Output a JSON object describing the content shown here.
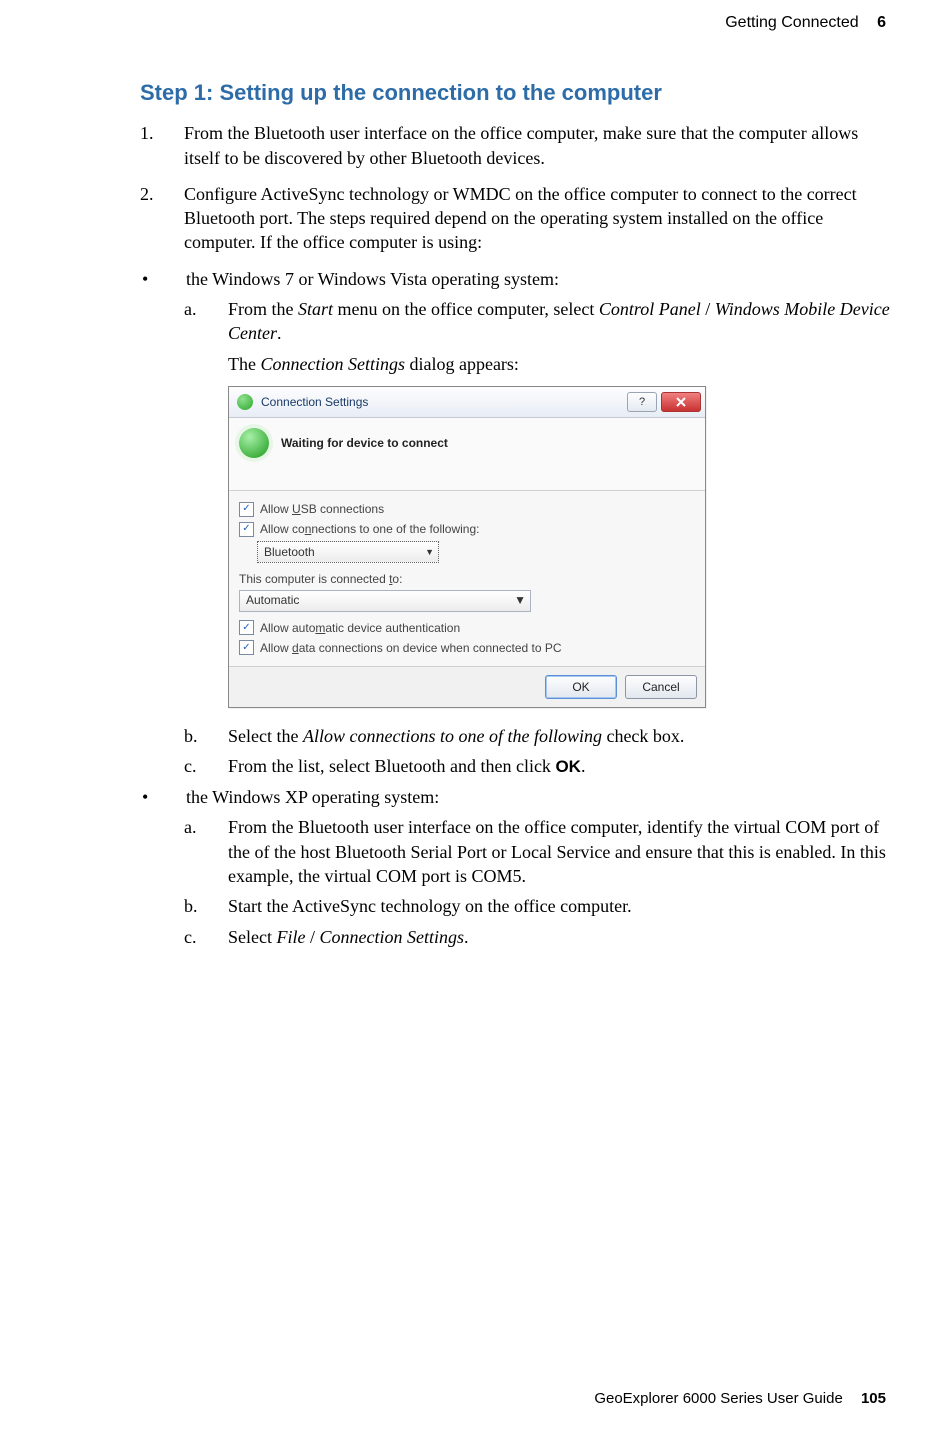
{
  "header": {
    "chapter_title": "Getting Connected",
    "chapter_number": "6"
  },
  "step_heading": "Step 1: Setting up the connection to the computer",
  "item1_num": "1.",
  "item1_text": "From the Bluetooth user interface on the office computer, make sure that the computer allows itself to be discovered by other Bluetooth devices.",
  "item2_num": "2.",
  "item2_text": "Configure ActiveSync technology or WMDC on the office computer to connect to the correct Bluetooth port. The steps required depend on the operating system installed on the office computer. If the office computer is using:",
  "bullet": "•",
  "bullet1_text": "the Windows 7 or Windows Vista operating system:",
  "win7_a_let": "a.",
  "win7_a_pre": "From the ",
  "win7_a_start": "Start",
  "win7_a_mid": " menu on the office computer, select ",
  "win7_a_cp": "Control Panel",
  "win7_a_sep": " / ",
  "win7_a_wmdc": "Windows Mobile Device Center",
  "win7_a_end": ".",
  "win7_a2_pre": "The ",
  "win7_a2_cs": "Connection Settings",
  "win7_a2_post": " dialog appears:",
  "win7_b_let": "b.",
  "win7_b_pre": "Select the ",
  "win7_b_italic": "Allow connections to one of the following",
  "win7_b_post": " check box.",
  "win7_c_let": "c.",
  "win7_c_pre": "From the list, select Bluetooth and then click ",
  "win7_c_ok": "OK",
  "win7_c_post": ".",
  "bullet2_text": "the Windows XP operating system:",
  "xp_a_let": "a.",
  "xp_a_text": "From the Bluetooth user interface on the office computer, identify the virtual COM port of the of the host Bluetooth Serial Port or Local Service and ensure that this is enabled. In this example, the virtual COM port is COM5.",
  "xp_b_let": "b.",
  "xp_b_text": "Start the ActiveSync technology on the office computer.",
  "xp_c_let": "c.",
  "xp_c_pre": "Select ",
  "xp_c_file": "File",
  "xp_c_sep": " / ",
  "xp_c_cs": "Connection Settings",
  "xp_c_post": ".",
  "dialog": {
    "title": "Connection Settings",
    "help_glyph": "?",
    "status": "Waiting for device to connect",
    "chk_usb_pre": "Allow ",
    "chk_usb_u": "U",
    "chk_usb_post": "SB connections",
    "chk_conn_pre": "Allow co",
    "chk_conn_u": "n",
    "chk_conn_post": "nections to one of the following:",
    "select_conn": "Bluetooth",
    "lbl_connected_pre": "This computer is connected ",
    "lbl_connected_u": "t",
    "lbl_connected_post": "o:",
    "select_connected": "Automatic",
    "chk_auth_pre": "Allow auto",
    "chk_auth_u": "m",
    "chk_auth_post": "atic device authentication",
    "chk_data_pre": "Allow ",
    "chk_data_u": "d",
    "chk_data_post": "ata connections on device when connected to PC",
    "btn_ok": "OK",
    "btn_cancel": "Cancel"
  },
  "footer": {
    "guide": "GeoExplorer 6000 Series User Guide",
    "page": "105"
  }
}
